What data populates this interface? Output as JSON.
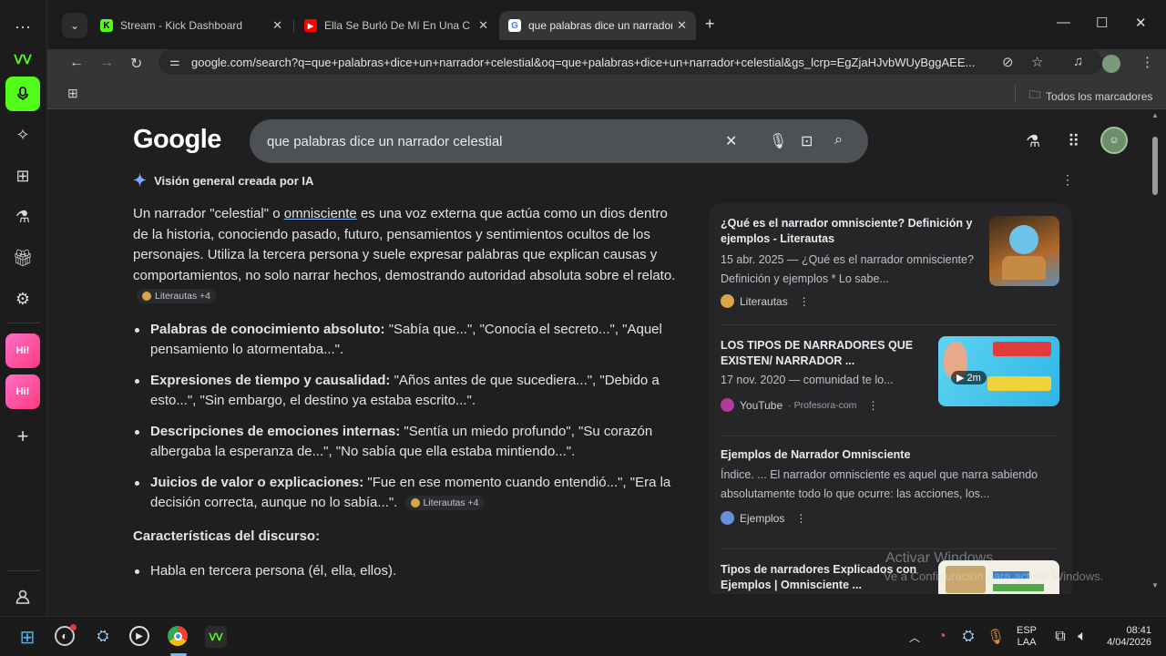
{
  "tabs": [
    {
      "title": "Stream - Kick Dashboard",
      "favicon": "kick-icon"
    },
    {
      "title": "Ella Se Burló De Mí En Una Cen",
      "favicon": "youtube-icon"
    },
    {
      "title": "que palabras dice un narrador c",
      "favicon": "google-icon"
    }
  ],
  "address": {
    "url": "google.com/search?q=que+palabras+dice+un+narrador+celestial&oq=que+palabras+dice+un+narrador+celestial&gs_lcrp=EgZjaHJvbWUyBggAEE..."
  },
  "bookmarks": {
    "all_label": "Todos los marcadores"
  },
  "search": {
    "logo": "Google",
    "query": "que palabras dice un narrador celestial"
  },
  "ai_overview": {
    "header": "Visión general creada por IA",
    "intro_before": "Un narrador \"celestial\" o ",
    "intro_link": "omnisciente",
    "intro_after": " es una voz externa que actúa como un dios dentro de la historia, conociendo pasado, futuro, pensamientos y sentimientos ocultos de los personajes. Utiliza la tercera persona y suele expresar palabras que explican causas y comportamientos, no solo narrar hechos, demostrando autoridad absoluta sobre el relato.",
    "chip_label": "Literautas +4",
    "bullets": [
      {
        "bold": "Palabras de conocimiento absoluto:",
        "text": " \"Sabía que...\", \"Conocía el secreto...\", \"Aquel pensamiento lo atormentaba...\"."
      },
      {
        "bold": "Expresiones de tiempo y causalidad:",
        "text": " \"Años antes de que sucediera...\", \"Debido a esto...\", \"Sin embargo, el destino ya estaba escrito...\"."
      },
      {
        "bold": "Descripciones de emociones internas:",
        "text": " \"Sentía un miedo profundo\", \"Su corazón albergaba la esperanza de...\", \"No sabía que ella estaba mintiendo...\"."
      },
      {
        "bold": "Juicios de valor o explicaciones:",
        "text": " \"Fue en ese momento cuando entendió...\", \"Era la decisión correcta, aunque no lo sabía...\"."
      }
    ],
    "chip_label_2": "Literautas +4",
    "section_title": "Características del discurso:",
    "section_bullets": [
      "Habla en tercera persona (él, ella, ellos)."
    ]
  },
  "sources": [
    {
      "title": "¿Qué es el narrador omnisciente? Definición y ejemplos - Literautas",
      "snippet": "15 abr. 2025 — ¿Qué es el narrador omnisciente? Definición y ejemplos * Lo sabe...",
      "site": "Literautas",
      "site_extra": "",
      "thumb": "cartoon"
    },
    {
      "title": "LOS TIPOS DE NARRADORES QUE EXISTEN/ NARRADOR ...",
      "snippet": "17 nov. 2020 — comunidad te lo...",
      "site": "YouTube",
      "site_extra": "· Profesora-com",
      "duration": "2m",
      "thumb": "video"
    },
    {
      "title": "Ejemplos de Narrador Omnisciente",
      "snippet": "Índice. ... El narrador omnisciente es aquel que narra sabiendo absolutamente todo lo que ocurre: las acciones, los...",
      "site": "Ejemplos",
      "site_extra": "",
      "thumb": ""
    },
    {
      "title": "Tipos de narradores Explicados con Ejemplos | Omnisciente ...",
      "snippet": "",
      "site": "",
      "site_extra": "",
      "thumb": "chart"
    }
  ],
  "watermark": {
    "line1": "Activar Windows",
    "line2": "Ve a Configuración para activar Windows."
  },
  "taskbar": {
    "lang_top": "ESP",
    "lang_bottom": "LAA",
    "time": "08:41",
    "date": "4/04/2026"
  },
  "colors": {
    "kick_green": "#53fc18",
    "page_bg": "#1f1f1f",
    "search_bg": "#4d5156",
    "link_blue": "#8ab4f8"
  }
}
